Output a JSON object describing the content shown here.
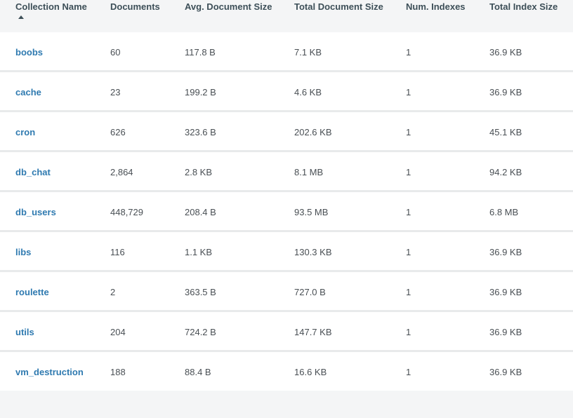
{
  "columns": [
    {
      "label": "Collection Name"
    },
    {
      "label": "Documents"
    },
    {
      "label": "Avg. Document Size"
    },
    {
      "label": "Total Document Size"
    },
    {
      "label": "Num. Indexes"
    },
    {
      "label": "Total Index Size"
    }
  ],
  "sort": {
    "column": "Collection Name",
    "direction": "ascending",
    "icon": "sort-ascending-icon"
  },
  "rows": [
    {
      "name": "boobs",
      "documents": "60",
      "avg_size": "117.8 B",
      "total_size": "7.1 KB",
      "indexes": "1",
      "index_size": "36.9 KB"
    },
    {
      "name": "cache",
      "documents": "23",
      "avg_size": "199.2 B",
      "total_size": "4.6 KB",
      "indexes": "1",
      "index_size": "36.9 KB"
    },
    {
      "name": "cron",
      "documents": "626",
      "avg_size": "323.6 B",
      "total_size": "202.6 KB",
      "indexes": "1",
      "index_size": "45.1 KB"
    },
    {
      "name": "db_chat",
      "documents": "2,864",
      "avg_size": "2.8 KB",
      "total_size": "8.1 MB",
      "indexes": "1",
      "index_size": "94.2 KB"
    },
    {
      "name": "db_users",
      "documents": "448,729",
      "avg_size": "208.4 B",
      "total_size": "93.5 MB",
      "indexes": "1",
      "index_size": "6.8 MB"
    },
    {
      "name": "libs",
      "documents": "116",
      "avg_size": "1.1 KB",
      "total_size": "130.3 KB",
      "indexes": "1",
      "index_size": "36.9 KB"
    },
    {
      "name": "roulette",
      "documents": "2",
      "avg_size": "363.5 B",
      "total_size": "727.0 B",
      "indexes": "1",
      "index_size": "36.9 KB"
    },
    {
      "name": "utils",
      "documents": "204",
      "avg_size": "724.2 B",
      "total_size": "147.7 KB",
      "indexes": "1",
      "index_size": "36.9 KB"
    },
    {
      "name": "vm_destruction",
      "documents": "188",
      "avg_size": "88.4 B",
      "total_size": "16.6 KB",
      "indexes": "1",
      "index_size": "36.9 KB"
    }
  ],
  "colors": {
    "link": "#2f7ab0",
    "header_text": "#3d4f58",
    "cell_text": "#494f54",
    "row_background": "#ffffff",
    "page_background": "#f4f5f6",
    "row_divider": "#e8eaeb"
  }
}
